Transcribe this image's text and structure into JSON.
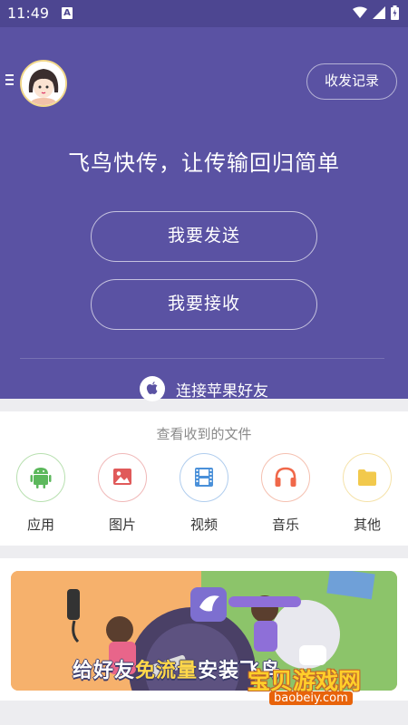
{
  "status_bar": {
    "time": "11:49",
    "notification_icon": "A"
  },
  "header": {
    "menu_icon": "menu-icon",
    "history_button": "收发记录",
    "slogan": "飞鸟快传，让传输回归简单",
    "send_button": "我要发送",
    "receive_button": "我要接收",
    "apple_link": "连接苹果好友"
  },
  "files": {
    "title": "查看收到的文件",
    "categories": [
      {
        "label": "应用",
        "icon": "android-icon",
        "color": "#5cb85c"
      },
      {
        "label": "图片",
        "icon": "image-icon",
        "color": "#e05a5a"
      },
      {
        "label": "视频",
        "icon": "film-icon",
        "color": "#4a90d9"
      },
      {
        "label": "音乐",
        "icon": "headphones-icon",
        "color": "#f0684a"
      },
      {
        "label": "其他",
        "icon": "folder-icon",
        "color": "#f2c94c"
      }
    ]
  },
  "banner": {
    "text_before": "给好友",
    "text_highlight": "免流量",
    "text_after": "安装飞鸟"
  },
  "watermark": {
    "title": "宝贝游戏网",
    "url": "baobeiy.com"
  }
}
